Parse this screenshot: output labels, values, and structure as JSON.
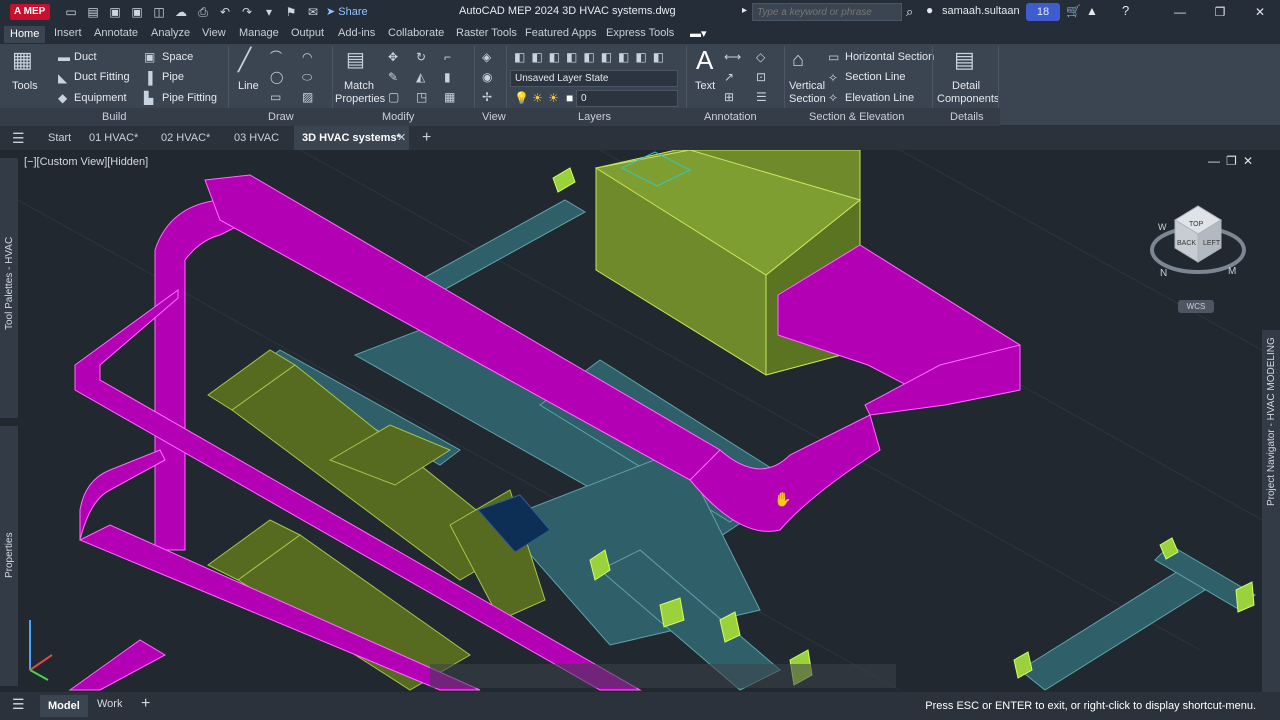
{
  "app": {
    "logo": "A MEP",
    "title": "AutoCAD MEP 2024  3D HVAC systems.dwg",
    "share": "Share",
    "search_placeholder": "Type a keyword or phrase",
    "user": "samaah.sultaan",
    "badge": "18"
  },
  "ribbon_tabs": [
    "Home",
    "Insert",
    "Annotate",
    "Analyze",
    "View",
    "Manage",
    "Output",
    "Add-ins",
    "Collaborate",
    "Raster Tools",
    "Featured Apps",
    "Express Tools"
  ],
  "build": {
    "tools": "Tools",
    "duct": "Duct",
    "duct_fitting": "Duct Fitting",
    "equipment": "Equipment",
    "space": "Space",
    "pipe": "Pipe",
    "pipe_fitting": "Pipe Fitting",
    "label": "Build"
  },
  "draw": {
    "line": "Line",
    "label": "Draw"
  },
  "modify": {
    "match1": "Match",
    "match2": "Properties",
    "label": "Modify"
  },
  "view_panel": {
    "label": "View"
  },
  "layers": {
    "layer_state": "Unsaved Layer State",
    "layer": "0",
    "label": "Layers"
  },
  "annotation": {
    "text": "Text",
    "label": "Annotation"
  },
  "section": {
    "vertical1": "Vertical",
    "vertical2": "Section",
    "horizontal": "Horizontal Section",
    "section_line": "Section Line",
    "elevation_line": "Elevation Line",
    "label": "Section & Elevation"
  },
  "details": {
    "detail1": "Detail",
    "detail2": "Components",
    "label": "Details"
  },
  "doc_tabs": [
    "Start",
    "01 HVAC*",
    "02 HVAC*",
    "03 HVAC",
    "3D HVAC systems*"
  ],
  "viewport": {
    "label": "[−][Custom View][Hidden]",
    "wcs": "WCS",
    "left_palette": "Tool Palettes - HVAC",
    "left_props": "Properties",
    "right_palette": "Project Navigator - HVAC MODELING",
    "cube_top": "TOP",
    "cube_back": "BACK",
    "cube_left": "LEFT",
    "compass_n": "N",
    "compass_m": "M",
    "compass_w": "W"
  },
  "status": {
    "model": "Model",
    "work": "Work",
    "prompt": "Press ESC or ENTER to exit, or right-click to display shortcut-menu."
  },
  "colors": {
    "duct_magenta": "#b400b4",
    "duct_teal": "#2f5f68",
    "duct_olive": "#566b1f",
    "ahu": "#6e8a2a"
  }
}
